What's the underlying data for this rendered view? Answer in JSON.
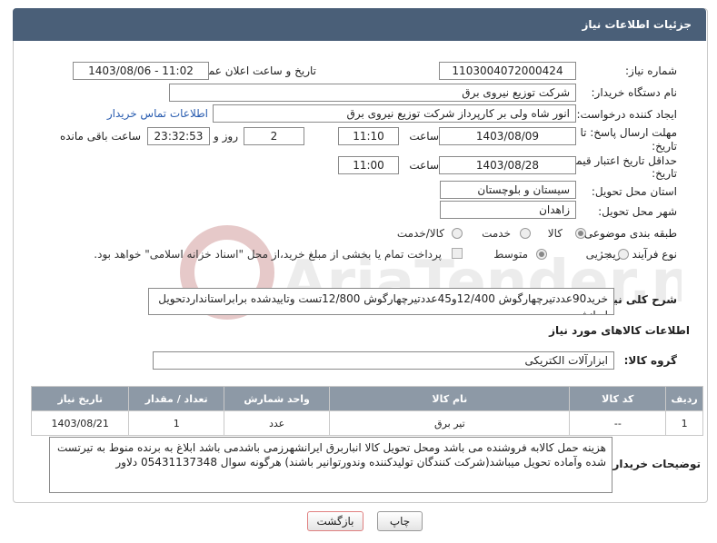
{
  "header": {
    "title": "جزئیات اطلاعات نیاز"
  },
  "form": {
    "need_number": {
      "label": "شماره نیاز:",
      "value": "1103004072000424"
    },
    "announce_datetime": {
      "label": "تاریخ و ساعت اعلان عمومی:",
      "value": "1403/08/06 - 11:02"
    },
    "buyer_org": {
      "label": "نام دستگاه خریدار:",
      "value": "شرکت توزیع نیروی برق"
    },
    "creator": {
      "label": "ایجاد کننده درخواست:",
      "value": "انور شاه ولی بر کارپرداز شرکت توزیع نیروی برق",
      "contact_link": "اطلاعات تماس خریدار"
    },
    "reply_deadline": {
      "label_line1": "مهلت ارسال پاسخ: تا",
      "label_line2": "تاریخ:",
      "date": "1403/08/09",
      "time_label": "ساعت",
      "time": "11:10",
      "days": "2",
      "days_label": "روز و",
      "remaining": "23:32:53",
      "remaining_label": "ساعت باقی مانده"
    },
    "price_validity": {
      "label_line1": "حداقل تاریخ اعتبار قیمت: تا",
      "label_line2": "تاریخ:",
      "date": "1403/08/28",
      "time_label": "ساعت",
      "time": "11:00"
    },
    "province": {
      "label": "استان محل تحویل:",
      "value": "سیستان و بلوچستان"
    },
    "city": {
      "label": "شهر محل تحویل:",
      "value": "زاهدان"
    },
    "category": {
      "label": "طبقه بندی موضوعی:",
      "options": [
        "کالا",
        "خدمت",
        "کالا/خدمت"
      ],
      "selected": "کالا"
    },
    "purchase_type": {
      "label": "نوع فرآیند خرید :",
      "options": [
        "جزیی",
        "متوسط"
      ],
      "selected": "متوسط",
      "payment_note": "پرداخت تمام یا بخشی از مبلغ خرید،از محل \"اسناد خزانه اسلامی\" خواهد بود."
    }
  },
  "general_description": {
    "label": "شرح کلی نیاز:",
    "value": "خرید90عددتیرچهارگوش 12/400و45عددتیرچهارگوش 12/800تست وتاییدشده برابراستانداردتحویل ایرانشهر"
  },
  "goods_section": {
    "title": "اطلاعات کالاهای مورد نیاز",
    "group_label": "گروه کالا:",
    "group_value": "ابزارآلات الکتریکی"
  },
  "table": {
    "headers": [
      "ردیف",
      "کد کالا",
      "نام کالا",
      "واحد شمارش",
      "تعداد / مقدار",
      "تاریخ نیاز"
    ],
    "rows": [
      [
        "1",
        "--",
        "تیر برق",
        "عدد",
        "1",
        "1403/08/21"
      ]
    ]
  },
  "buyer_notes": {
    "label": "توضیحات خریدار:",
    "value": "هزینه حمل کالابه فروشنده می باشد ومحل تحویل کالا انباربرق  ایرانشهرزمی باشدمی باشد ابلاغ به برنده منوط به تیرتست شده وآماده تحویل میباشد(شرکت کنندگان تولیدکننده وندورتوانیر باشند) هرگونه سوال 05431137348 دلاور"
  },
  "buttons": {
    "print": "چاپ",
    "back": "بازگشت"
  },
  "watermark": {
    "text": "AriaTender.neT"
  },
  "colors": {
    "header_bg": "#4a5f78",
    "table_header_bg": "#8d99a6",
    "link": "#2a5db0",
    "back_btn_border": "#e08080"
  }
}
